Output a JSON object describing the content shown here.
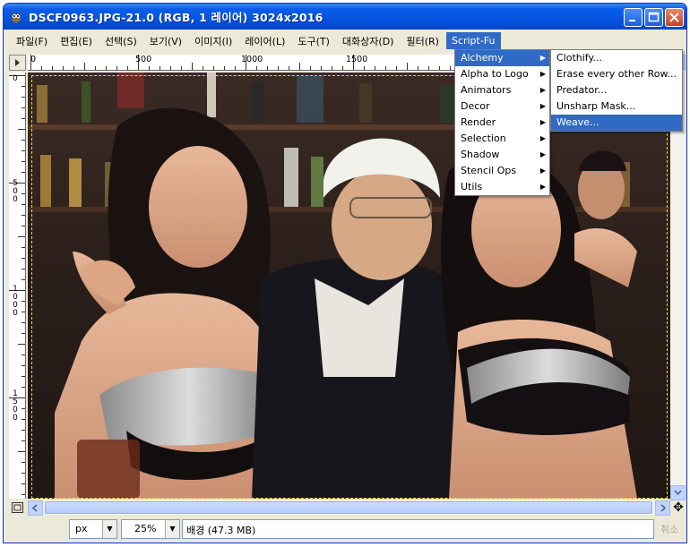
{
  "window": {
    "title": "DSCF0963.JPG-21.0 (RGB, 1 레이어) 3024x2016"
  },
  "menubar": {
    "items": [
      {
        "label": "파일(F)"
      },
      {
        "label": "편집(E)"
      },
      {
        "label": "선택(S)"
      },
      {
        "label": "보기(V)"
      },
      {
        "label": "이미지(I)"
      },
      {
        "label": "레이어(L)"
      },
      {
        "label": "도구(T)"
      },
      {
        "label": "대화상자(D)"
      },
      {
        "label": "필터(R)"
      },
      {
        "label": "Script-Fu"
      }
    ],
    "active": "Script-Fu"
  },
  "script_fu_menu": {
    "items": [
      {
        "label": "Alchemy",
        "submenu": true
      },
      {
        "label": "Alpha to Logo",
        "submenu": true
      },
      {
        "label": "Animators",
        "submenu": true
      },
      {
        "label": "Decor",
        "submenu": true
      },
      {
        "label": "Render",
        "submenu": true
      },
      {
        "label": "Selection",
        "submenu": true
      },
      {
        "label": "Shadow",
        "submenu": true
      },
      {
        "label": "Stencil Ops",
        "submenu": true
      },
      {
        "label": "Utils",
        "submenu": true
      }
    ],
    "highlighted": "Alchemy"
  },
  "alchemy_submenu": {
    "items": [
      {
        "label": "Clothify..."
      },
      {
        "label": "Erase every other Row..."
      },
      {
        "label": "Predator..."
      },
      {
        "label": "Unsharp Mask..."
      },
      {
        "label": "Weave..."
      }
    ],
    "highlighted": "Weave..."
  },
  "rulers": {
    "horizontal_labels": [
      "0",
      "500",
      "1000",
      "1500"
    ],
    "vertical_labels": [
      "0",
      "500",
      "1000",
      "1500"
    ]
  },
  "statusbar": {
    "unit": "px",
    "zoom": "25%",
    "status_text": "배경 (47.3 MB)",
    "cancel_label": "취소"
  },
  "icons": {
    "menu_toggle": "triangle-right-icon",
    "navigate": "navigate-icon",
    "move": "four-arrow-move-icon"
  },
  "colors": {
    "title_bar": "#0553e0",
    "menu_highlight": "#316ac5",
    "selection_border": "#e9d245"
  }
}
